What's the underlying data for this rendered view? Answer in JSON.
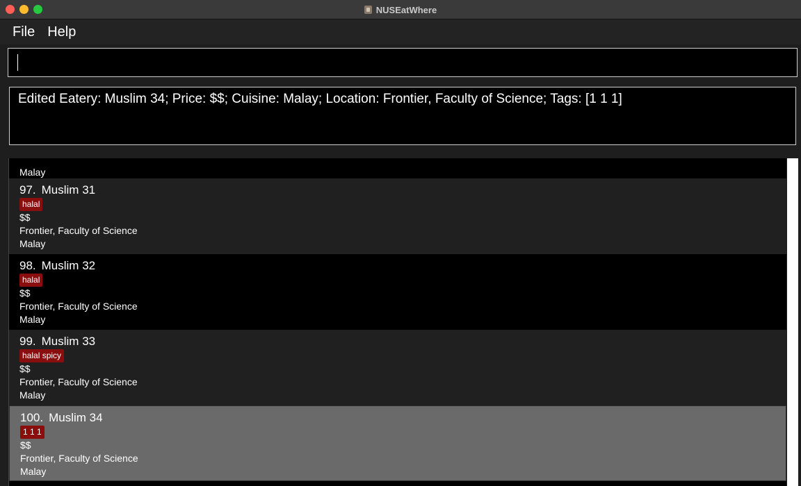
{
  "window": {
    "title": "NUSEatWhere"
  },
  "menu": {
    "file": "File",
    "help": "Help"
  },
  "command": {
    "value": ""
  },
  "result": {
    "text": "Edited Eatery: Muslim 34; Price: $$; Cuisine: Malay; Location: Frontier, Faculty of Science; Tags: [1 1 1]"
  },
  "list": {
    "partial_card": {
      "cuisine": "Malay"
    },
    "cards": [
      {
        "index": "97.",
        "name": "Muslim 31",
        "tags": [
          "halal"
        ],
        "price": "$$",
        "location": "Frontier, Faculty of Science",
        "cuisine": "Malay"
      },
      {
        "index": "98.",
        "name": "Muslim 32",
        "tags": [
          "halal"
        ],
        "price": "$$",
        "location": "Frontier, Faculty of Science",
        "cuisine": "Malay"
      },
      {
        "index": "99.",
        "name": "Muslim 33",
        "tags": [
          "halal spicy"
        ],
        "price": "$$",
        "location": "Frontier, Faculty of Science",
        "cuisine": "Malay"
      },
      {
        "index": "100.",
        "name": "Muslim 34",
        "tags": [
          "1 1 1"
        ],
        "price": "$$",
        "location": "Frontier, Faculty of Science",
        "cuisine": "Malay"
      }
    ]
  },
  "colors": {
    "tag_bg": "#8a0e0e",
    "selected_bg": "#6a6a6a",
    "window_bg": "#1e1e1e"
  }
}
